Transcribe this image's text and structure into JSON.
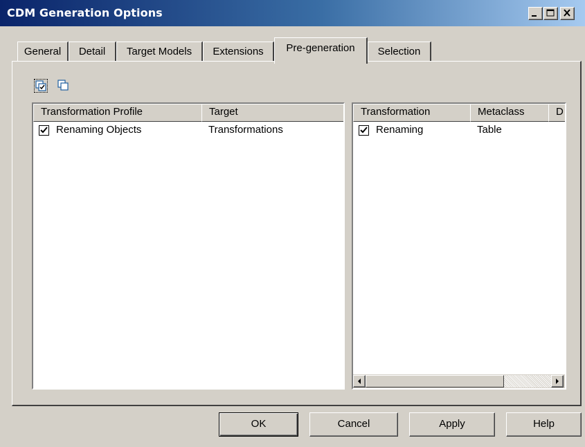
{
  "window": {
    "title": "CDM Generation Options",
    "controls": [
      "minimize-icon",
      "maximize-icon",
      "close-icon"
    ]
  },
  "tabs": [
    {
      "label": "General",
      "active": false
    },
    {
      "label": "Detail",
      "active": false
    },
    {
      "label": "Target Models",
      "active": false
    },
    {
      "label": "Extensions",
      "active": false
    },
    {
      "label": "Pre-generation",
      "active": true
    },
    {
      "label": "Selection",
      "active": false
    }
  ],
  "toolbar": {
    "icons": [
      "select-all-icon",
      "deselect-all-icon"
    ]
  },
  "left_list": {
    "columns": [
      "Transformation Profile",
      "Target"
    ],
    "rows": [
      {
        "checked": true,
        "profile": "Renaming Objects",
        "target": "Transformations"
      }
    ]
  },
  "right_list": {
    "columns": [
      "Transformation",
      "Metaclass",
      "D"
    ],
    "rows": [
      {
        "checked": true,
        "transformation": "Renaming",
        "metaclass": "Table"
      }
    ]
  },
  "buttons": {
    "ok": "OK",
    "cancel": "Cancel",
    "apply": "Apply",
    "help": "Help"
  },
  "colors": {
    "titlebar_start": "#0a246a",
    "titlebar_end": "#a6caf0",
    "face": "#d4d0c8"
  }
}
